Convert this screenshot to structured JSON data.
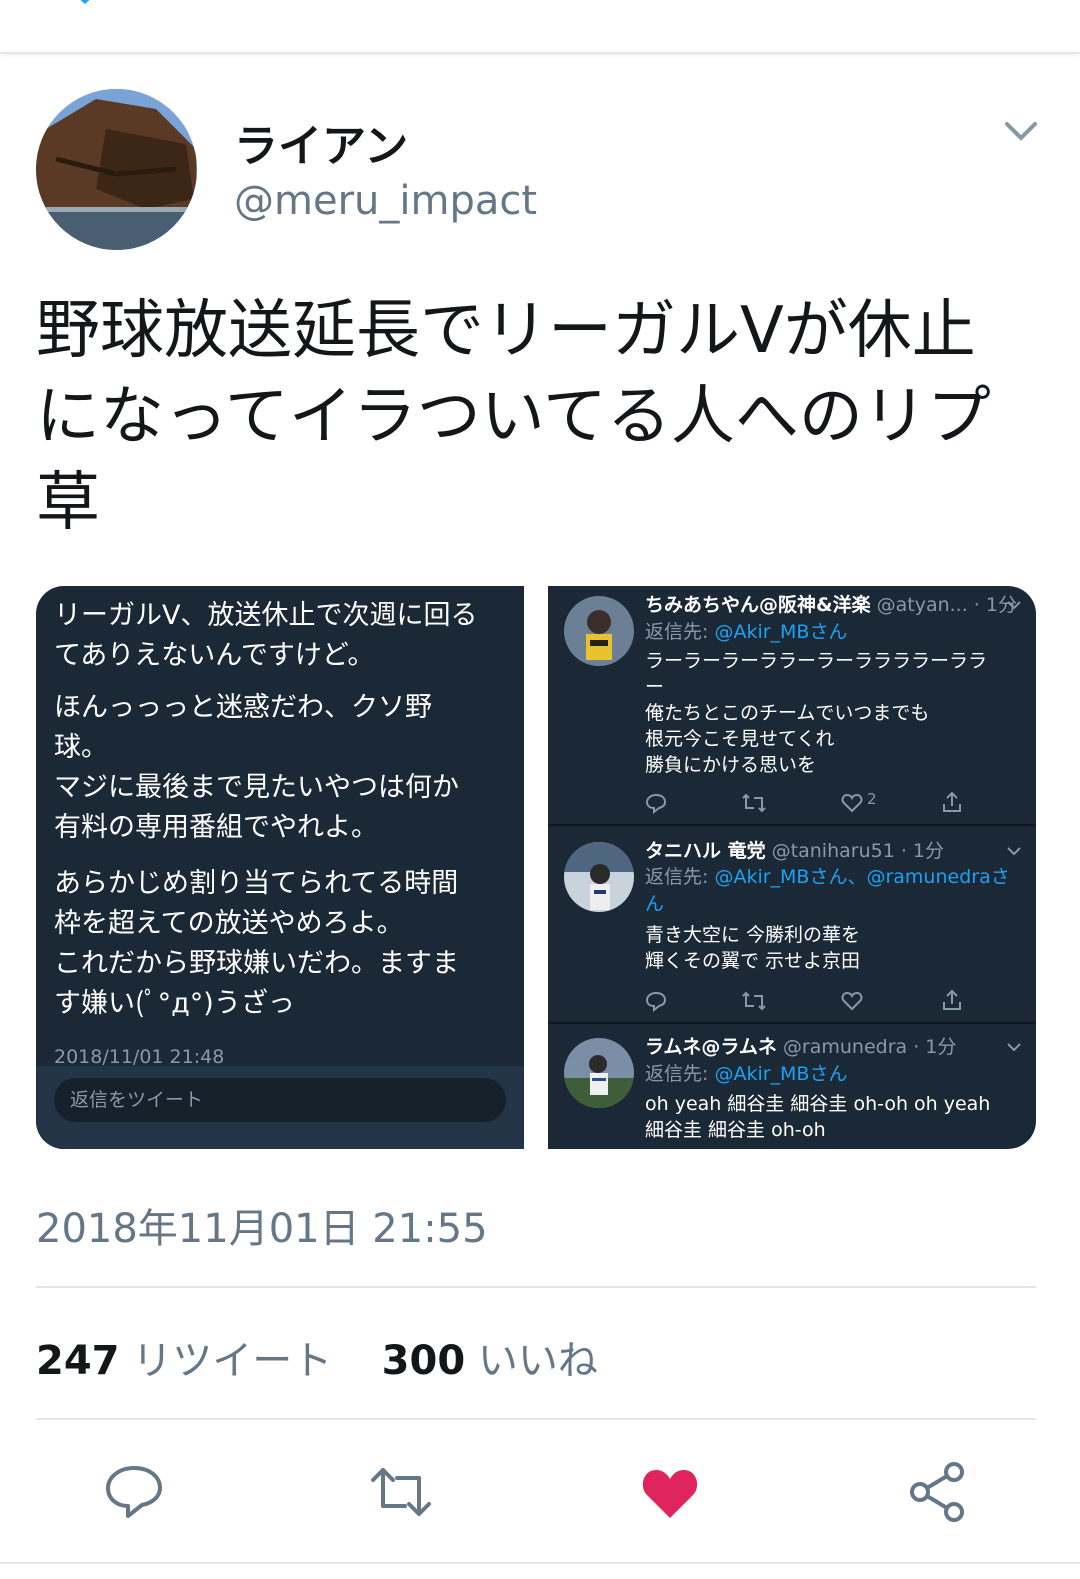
{
  "author": {
    "display_name": "ライアン",
    "handle": "@meru_impact"
  },
  "tweet": {
    "text_lines": [
      "野球放送延長でリーガルⅤが休止",
      "になってイラついてる人へのリプ",
      "草"
    ],
    "timestamp": "2018年11月01日 21:55"
  },
  "stats": {
    "retweets": "247",
    "retweets_label": "リツイート",
    "likes": "300",
    "likes_label": "いいね"
  },
  "media_left": {
    "paragraphs": [
      [
        "リーガルV、放送休止で次週に回る",
        "てありえないんですけど。"
      ],
      [
        "ほんっっっと迷惑だわ、クソ野",
        "球。",
        "マジに最後まで見たいやつは何か",
        "有料の専用番組でやれよ。"
      ],
      [
        "あらかじめ割り当てられてる時間",
        "枠を超えての放送やめろよ。",
        "これだから野球嫌いだわ。ますま",
        "す嫌い(ﾟ°д°)うざっ"
      ]
    ],
    "date": "2018/11/01 21:48",
    "reply_placeholder": "返信をツイート"
  },
  "media_right": {
    "replies": [
      {
        "name": "ちみあちやん@阪神&洋楽",
        "meta": " @atyan... · 1分",
        "reply_prefix": "返信先: ",
        "reply_to": "@Akir_MBさん",
        "lines": [
          "ラーラーラーララーラーララララーララ",
          "ー",
          "俺たちとこのチームでいつまでも",
          "根元今こそ見せてくれ",
          "勝負にかける思いを"
        ],
        "like_count": "2"
      },
      {
        "name": "タニハル 竜党",
        "meta": " @taniharu51 · 1分",
        "reply_prefix": "返信先: ",
        "reply_to": "@Akir_MBさん、@ramunedraさ",
        "reply_to_cont": "ん",
        "lines": [
          "青き大空に 今勝利の華を",
          "輝くその翼で 示せよ京田"
        ],
        "like_count": ""
      },
      {
        "name": "ラムネ@ラムネ",
        "meta": " @ramunedra · 1分",
        "reply_prefix": "返信先: ",
        "reply_to": "@Akir_MBさん",
        "lines": [
          "oh yeah 細谷圭 細谷圭  oh-oh oh yeah",
          "細谷圭  細谷圭 oh-oh"
        ],
        "like_count": ""
      }
    ]
  },
  "colors": {
    "like_active": "#e0245e",
    "secondary_text": "#657786",
    "link": "#1da1f2",
    "dark_bg": "#1b2836"
  },
  "icons": {
    "reply": "reply-icon",
    "retweet": "retweet-icon",
    "like": "heart-icon",
    "share": "share-icon",
    "caret": "chevron-down-icon"
  }
}
